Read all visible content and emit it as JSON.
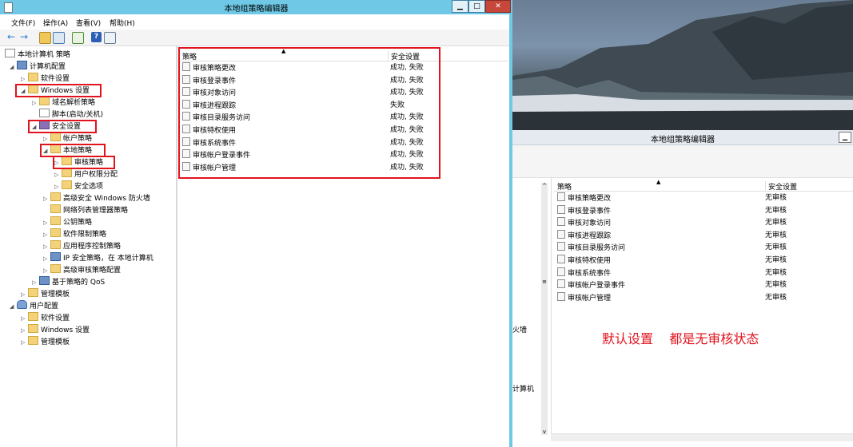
{
  "front_window": {
    "title": "本地组策略编辑器",
    "minimize": "▁",
    "maximize": "□",
    "close": "✕",
    "menu": [
      "文件(F)",
      "操作(A)",
      "查看(V)",
      "帮助(H)"
    ],
    "tree": [
      {
        "label": "本地计算机 策略"
      },
      {
        "label": "计算机配置"
      },
      {
        "label": "软件设置"
      },
      {
        "label": "Windows 设置"
      },
      {
        "label": "域名解析策略"
      },
      {
        "label": "脚本(启动/关机)"
      },
      {
        "label": "安全设置"
      },
      {
        "label": "帐户策略"
      },
      {
        "label": "本地策略"
      },
      {
        "label": "审核策略"
      },
      {
        "label": "用户权限分配"
      },
      {
        "label": "安全选项"
      },
      {
        "label": "高级安全 Windows 防火墙"
      },
      {
        "label": "网络列表管理器策略"
      },
      {
        "label": "公钥策略"
      },
      {
        "label": "软件限制策略"
      },
      {
        "label": "应用程序控制策略"
      },
      {
        "label": "IP 安全策略，在 本地计算机"
      },
      {
        "label": "高级审核策略配置"
      },
      {
        "label": "基于策略的 QoS"
      },
      {
        "label": "管理模板"
      },
      {
        "label": "用户配置"
      },
      {
        "label": "软件设置"
      },
      {
        "label": "Windows 设置"
      },
      {
        "label": "管理模板"
      }
    ],
    "columns": {
      "policy": "策略",
      "setting": "安全设置"
    },
    "rows": [
      {
        "policy": "审核策略更改",
        "setting": "成功, 失败"
      },
      {
        "policy": "审核登录事件",
        "setting": "成功, 失败"
      },
      {
        "policy": "审核对象访问",
        "setting": "成功, 失败"
      },
      {
        "policy": "审核进程跟踪",
        "setting": "失败"
      },
      {
        "policy": "审核目录服务访问",
        "setting": "成功, 失败"
      },
      {
        "policy": "审核特权使用",
        "setting": "成功, 失败"
      },
      {
        "policy": "审核系统事件",
        "setting": "成功, 失败"
      },
      {
        "policy": "审核帐户登录事件",
        "setting": "成功, 失败"
      },
      {
        "policy": "审核帐户管理",
        "setting": "成功, 失败"
      }
    ]
  },
  "back_window": {
    "title": "本地组策略编辑器",
    "left_fragments": [
      "火墙",
      "计算机"
    ],
    "columns": {
      "policy": "策略",
      "setting": "安全设置"
    },
    "rows": [
      {
        "policy": "审核策略更改",
        "setting": "无审核"
      },
      {
        "policy": "审核登录事件",
        "setting": "无审核"
      },
      {
        "policy": "审核对象访问",
        "setting": "无审核"
      },
      {
        "policy": "审核进程跟踪",
        "setting": "无审核"
      },
      {
        "policy": "审核目录服务访问",
        "setting": "无审核"
      },
      {
        "policy": "审核特权使用",
        "setting": "无审核"
      },
      {
        "policy": "审核系统事件",
        "setting": "无审核"
      },
      {
        "policy": "审核帐户登录事件",
        "setting": "无审核"
      },
      {
        "policy": "审核帐户管理",
        "setting": "无审核"
      }
    ],
    "annotation": "默认设置    都是无审核状态"
  },
  "colors": {
    "highlight_box": "#e1141e",
    "titlebar": "#6ec8e6",
    "annotation": "#e1141e"
  }
}
